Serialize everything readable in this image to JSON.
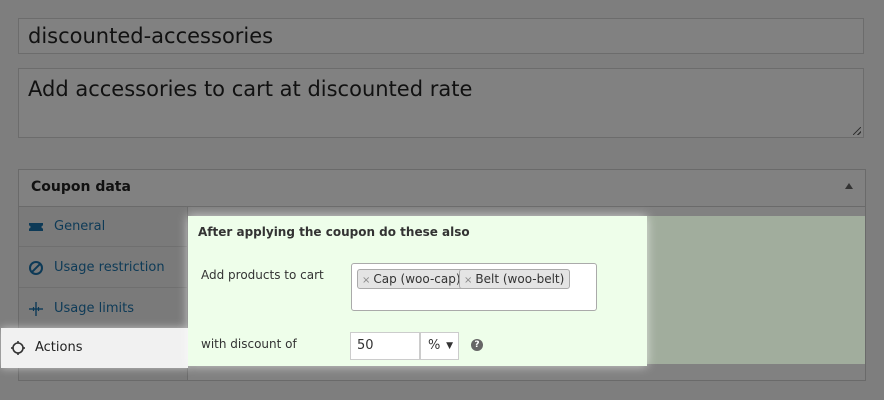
{
  "post": {
    "title": "discounted-accessories",
    "excerpt": "Add accessories to cart at discounted rate"
  },
  "coupon_panel": {
    "title": "Coupon data",
    "tabs": [
      {
        "label": "General",
        "icon": "ticket-icon"
      },
      {
        "label": "Usage restriction",
        "icon": "no-entry-icon"
      },
      {
        "label": "Usage limits",
        "icon": "crosshair-icon"
      },
      {
        "label": "Actions",
        "icon": "gear-icon"
      }
    ],
    "active_tab": "Actions"
  },
  "actions": {
    "heading": "After applying the coupon do these also",
    "products_label": "Add products to cart",
    "products": [
      {
        "label": "Cap (woo-cap)",
        "remove": "×"
      },
      {
        "label": "Belt (woo-belt)",
        "remove": "×"
      }
    ],
    "discount_label": "with discount of",
    "discount_value": "50",
    "discount_type": "%",
    "select_caret": "▼",
    "help": "?"
  },
  "colors": {
    "overlay": "#7e7e7e",
    "highlight_bg": "#eefeea",
    "active_tab_bg": "#f1f1f1",
    "link": "#0d3a57"
  }
}
